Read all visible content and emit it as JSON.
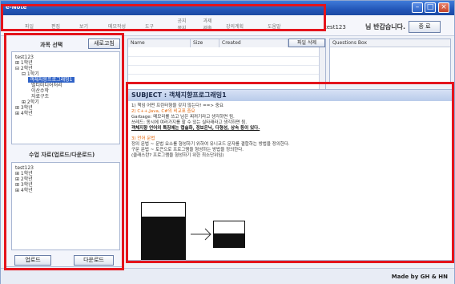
{
  "window": {
    "title": "e-Note"
  },
  "menu": {
    "items": [
      "파일",
      "편집",
      "보기",
      "메모작성",
      "도구",
      "공지 쪽지",
      "과제 제출",
      "강의계획",
      "도움말"
    ],
    "user": "test123",
    "greeting": "님 반갑습니다.",
    "logout_label": "종 료"
  },
  "course_panel": {
    "title": "과목 선택",
    "refresh_label": "새로고침",
    "tree": [
      "test123",
      "⊞ 1학년",
      "⊟ 2학년",
      "⊟ 1학기",
      "객체지향프로그래밍1",
      "멀티미디어처리",
      "이산수학",
      "자료구조",
      "⊞ 2학기",
      "⊞ 3학년",
      "⊞ 4학년"
    ]
  },
  "materials_panel": {
    "title": "수업 자료(업로드/다운로드)",
    "tree": [
      "test123",
      "⊞ 1학년",
      "⊞ 2학년",
      "⊞ 3학년",
      "⊞ 4학년"
    ],
    "upload_label": "업로드",
    "download_label": "다운로드"
  },
  "files": {
    "columns": [
      "Name",
      "Size",
      "Created"
    ],
    "delete_label": "파일 삭제"
  },
  "questions": {
    "title": "Questions Box"
  },
  "content": {
    "subject": "SUBJECT : 객체지향프로그래밍1",
    "line1": "1) 책임 어떤 프린터형을 갖지 않는다! ==> 중요",
    "line2": "2) C++,Java, C#의 비교표 중요",
    "line3": "Garbage: 메모리를 쓰고 남은 찌꺼기라고 생각하면 됨.",
    "line4": "쓰레드: 동시에 여러가지를 할 수 있는 실타래라고 생각하면 됨.",
    "line5": "객체지향 언어의 특징에는 캡슐화, 정보은닉, 다형성, 상속 등이 있다.",
    "line6": "3) 언어 문법",
    "line7": "정의 문법 ~ 문법 요소를 형성하기 위하여 유니코드 문자를 결합하는 방법을 정의한다.",
    "line8": "구문 문법 ~ 토큰으로 프로그램을 형성하는 방법을 정의한다.",
    "line9": "(클래스란? 프로그램을 형성하기 위한 최소단위임)"
  },
  "status": {
    "credit": "Made by GH & HN"
  }
}
